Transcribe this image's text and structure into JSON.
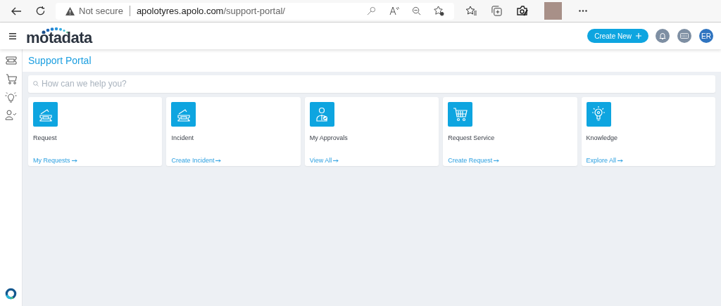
{
  "browser": {
    "security": "Not secure",
    "url_host": "apolotyres.apolo.com",
    "url_path": "/support-portal/"
  },
  "header": {
    "logo": "motadata",
    "create_button": "Create New",
    "avatar": "ER"
  },
  "page_title": "Support Portal",
  "search": {
    "placeholder": "How can we help you?"
  },
  "cards": [
    {
      "title": "Request",
      "link": "My Requests"
    },
    {
      "title": "Incident",
      "link": "Create Incident"
    },
    {
      "title": "My Approvals",
      "link": "View All"
    },
    {
      "title": "Request Service",
      "link": "Create Request"
    },
    {
      "title": "Knowledge",
      "link": "Explore All"
    }
  ]
}
